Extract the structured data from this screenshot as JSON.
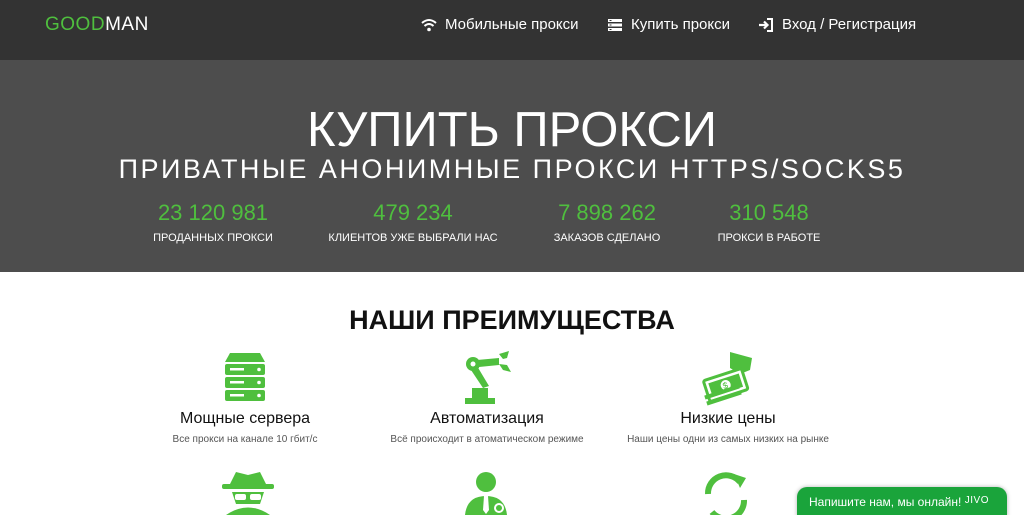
{
  "brand": {
    "logo_green": "GOOD",
    "logo_white": "MAN"
  },
  "nav": [
    {
      "icon": "wifi-icon",
      "label": "Мобильные прокси"
    },
    {
      "icon": "server-list-icon",
      "label": "Купить прокси"
    },
    {
      "icon": "login-icon",
      "label": "Вход / Регистрация"
    }
  ],
  "hero": {
    "title": "КУПИТЬ ПРОКСИ",
    "subtitle": "ПРИВАТНЫЕ АНОНИМНЫЕ ПРОКСИ HTTPS/SOCKS5",
    "stats": [
      {
        "value": "23 120 981",
        "label": "ПРОДАННЫХ ПРОКСИ"
      },
      {
        "value": "479 234",
        "label": "КЛИЕНТОВ УЖЕ ВЫБРАЛИ НАС"
      },
      {
        "value": "7 898 262",
        "label": "ЗАКАЗОВ СДЕЛАНО"
      },
      {
        "value": "310 548",
        "label": "ПРОКСИ В РАБОТЕ"
      }
    ]
  },
  "advantages": {
    "title": "НАШИ ПРЕИМУЩЕСТВА",
    "items": [
      {
        "icon": "server-icon",
        "title": "Мощные сервера",
        "desc": "Все прокси на канале 10 гбит/с"
      },
      {
        "icon": "robot-arm-icon",
        "title": "Автоматизация",
        "desc": "Всё происходит в атоматическом режиме"
      },
      {
        "icon": "money-hand-icon",
        "title": "Низкие цены",
        "desc": "Наши цены одни из самых низких на рынке"
      }
    ],
    "row2_icons": [
      "spy-icon",
      "support-agent-icon",
      "refresh-icon"
    ]
  },
  "chat": {
    "label": "Напишите нам, мы онлайн!",
    "brand": "JIVO"
  },
  "colors": {
    "accent": "#4fbf3e",
    "topbar": "#333333",
    "hero": "#4d4d4d",
    "chat": "#1aa43b"
  }
}
